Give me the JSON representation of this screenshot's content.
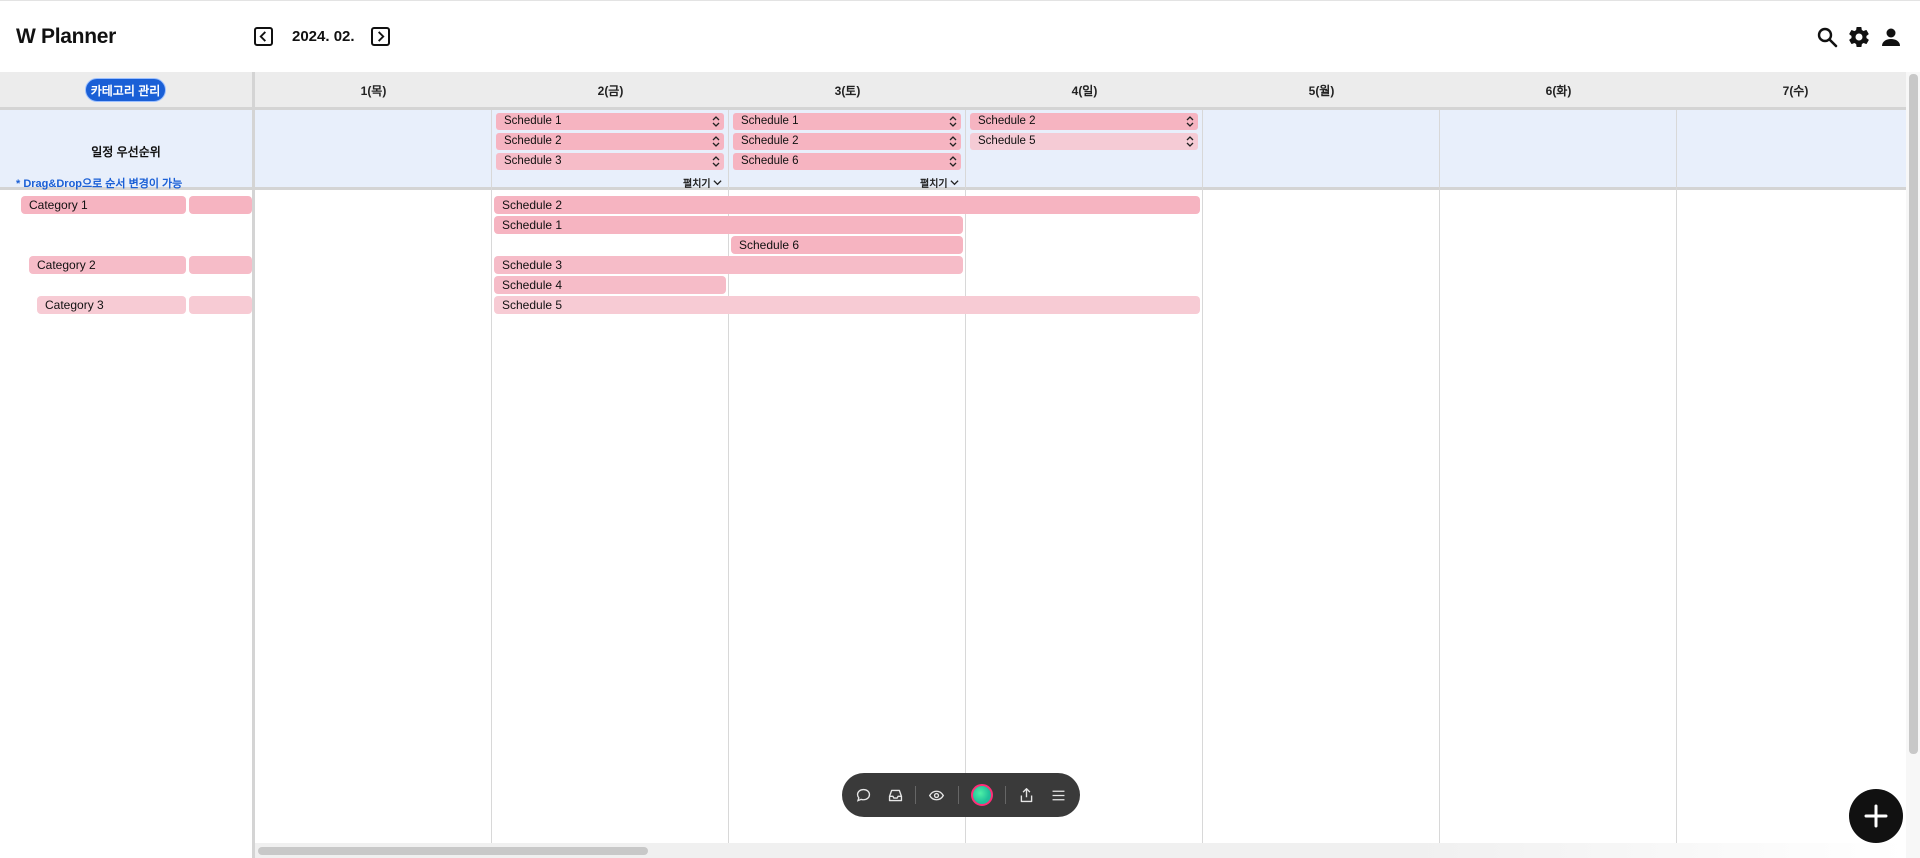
{
  "header": {
    "app_title": "W Planner",
    "date": "2024. 02.",
    "prev_icon": "chevron-left-icon",
    "next_icon": "chevron-right-icon",
    "icons": [
      "search-icon",
      "gear-icon",
      "user-icon"
    ]
  },
  "sidebar": {
    "category_manage_label": "카테고리 관리",
    "priority_title": "일정 우선순위",
    "priority_note": "* Drag&Drop으로 순서 변경이 가능",
    "categories": [
      {
        "label": "Category 1",
        "color": "#f6b4c1"
      },
      {
        "label": "Category 2",
        "color": "#f6bcc8"
      },
      {
        "label": "Category 3",
        "color": "#f7cbd4"
      }
    ]
  },
  "days": [
    "1(목)",
    "2(금)",
    "3(토)",
    "4(일)",
    "5(월)",
    "6(화)",
    "7(수)"
  ],
  "priority": {
    "day2": [
      "Schedule 1",
      "Schedule 2",
      "Schedule 3"
    ],
    "day3": [
      "Schedule 1",
      "Schedule 2",
      "Schedule 6"
    ],
    "day4": [
      "Schedule 2",
      "Schedule 5"
    ],
    "expand_label": "펼치기"
  },
  "schedules": [
    {
      "label": "Schedule 2",
      "category": "Category 1",
      "start": "2(금)",
      "end": "4(일)"
    },
    {
      "label": "Schedule 1",
      "category": "Category 1",
      "start": "2(금)",
      "end": "3(토)"
    },
    {
      "label": "Schedule 6",
      "category": "Category 1",
      "start": "3(토)",
      "end": "3(토)"
    },
    {
      "label": "Schedule 3",
      "category": "Category 2",
      "start": "2(금)",
      "end": "3(토)"
    },
    {
      "label": "Schedule 4",
      "category": "Category 2",
      "start": "2(금)",
      "end": "2(금)"
    },
    {
      "label": "Schedule 5",
      "category": "Category 3",
      "start": "2(금)",
      "end": "4(일)"
    }
  ],
  "toolbar": {
    "icons": [
      "comment-icon",
      "inbox-icon",
      "eye-settings-icon",
      "color-picker",
      "share-icon",
      "menu-icon"
    ]
  },
  "fab": {
    "icon": "plus-icon"
  },
  "colors": {
    "accent": "#1a5fd6",
    "schedule_pink": "#f6b4c1",
    "priority_bg": "#e8effb",
    "toolbar_bg": "#3a3a3a"
  }
}
